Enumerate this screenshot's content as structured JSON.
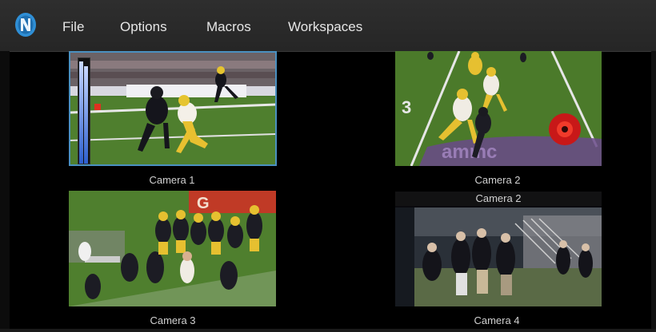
{
  "app": {
    "logo_icon": "newtek-n-logo"
  },
  "menu": {
    "items": [
      "File",
      "Options",
      "Macros",
      "Workspaces"
    ]
  },
  "monitors": [
    {
      "label": "Camera 1",
      "selected": true,
      "audio_level": 0.95
    },
    {
      "label": "Camera 2"
    },
    {
      "label": "Camera 3"
    },
    {
      "label": "Camera 4",
      "overlay_label": "Camera 2"
    }
  ],
  "colors": {
    "menubar": "#2a2a2a",
    "selection_border": "#4a90c0",
    "turf": "#4f7d2c",
    "gold_jersey": "#e2b82a",
    "dark_jersey": "#1c1c24"
  }
}
